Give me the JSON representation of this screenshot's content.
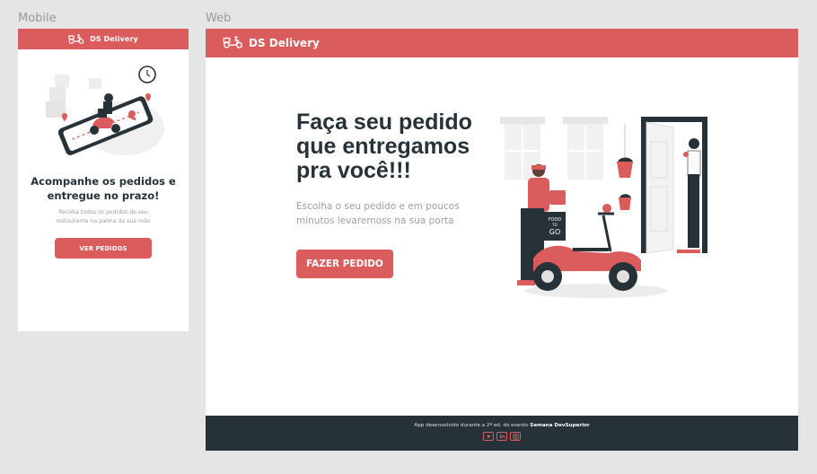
{
  "labels": {
    "mobile": "Mobile",
    "web": "Web"
  },
  "brand": {
    "name": "DS Delivery",
    "color": "#da5c5c",
    "icon": "scooter-icon"
  },
  "mobile": {
    "title": "Acompanhe os pedidos e entregue no prazo!",
    "subtitle": "Receba todos os pedidos do seu restaurante na palma da sua mão",
    "button": "VER PEDIDOS"
  },
  "web": {
    "title": "Faça seu pedido que entregamos pra você!!!",
    "subtitle": "Escolha o seu pedido e em poucos minutos levaremoss na sua porta",
    "button": "FAZER PEDIDO",
    "footer": {
      "credit_prefix": "App desenvolvido durante a 2ª ed. do evento",
      "credit_event": "Semana DevSuperior",
      "socials": [
        "youtube-icon",
        "linkedin-icon",
        "instagram-icon"
      ]
    },
    "illustration_text": [
      "FOOD",
      "TO",
      "GO"
    ]
  }
}
